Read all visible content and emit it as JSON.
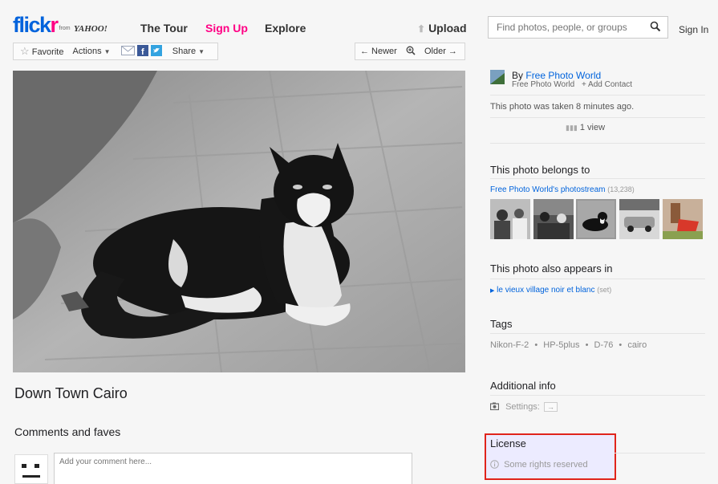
{
  "header": {
    "logo_flickr": "flick",
    "logo_r": "r",
    "logo_from": "from",
    "logo_yahoo": "YAHOO!",
    "nav": {
      "tour": "The Tour",
      "signup": "Sign Up",
      "explore": "Explore"
    },
    "upload": "Upload",
    "search_placeholder": "Find photos, people, or groups",
    "signin": "Sign In"
  },
  "toolbar": {
    "favorite": "Favorite",
    "actions": "Actions",
    "share": "Share",
    "newer": "← Newer",
    "older": "Older →"
  },
  "photo": {
    "title": "Down Town Cairo"
  },
  "comments": {
    "heading": "Comments and faves",
    "placeholder": "Add your comment here..."
  },
  "sidebar": {
    "by": "By",
    "owner": "Free Photo World",
    "owner_sub": "Free Photo World",
    "add_contact": "+ Add Contact",
    "taken": "This photo was taken 8 minutes ago.",
    "views": "1 view",
    "belongs_heading": "This photo belongs to",
    "photostream": "Free Photo World's photostream",
    "photostream_count": "(13,238)",
    "appears_heading": "This photo also appears in",
    "set_name": "le vieux village noir et blanc",
    "set_label": "(set)",
    "tags_heading": "Tags",
    "tags": [
      "Nikon-F-2",
      "HP-5plus",
      "D-76",
      "cairo"
    ],
    "additional_heading": "Additional info",
    "settings_label": "Settings:",
    "settings_btn": "→",
    "license_heading": "License",
    "license_text": "Some rights reserved"
  },
  "colors": {
    "brand_blue": "#0063dc",
    "brand_pink": "#ff0084",
    "highlight_border": "#e0241b",
    "highlight_bg": "#ecebff"
  }
}
